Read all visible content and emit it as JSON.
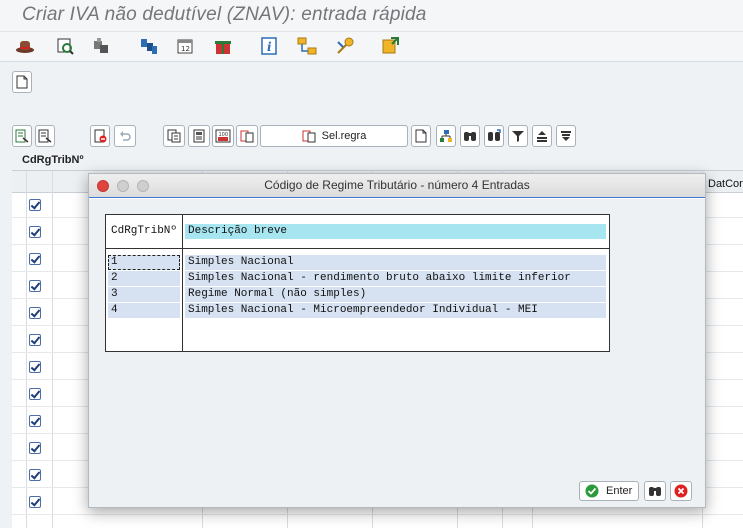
{
  "window": {
    "title": "Criar IVA não dedutível  (ZNAV): entrada rápida"
  },
  "toolbar": {
    "icons": [
      "hat-icon",
      "find-icon",
      "transport-icon",
      "structure-icon",
      "calendar-icon",
      "gift-icon",
      "info-icon",
      "flow-icon",
      "key-icon",
      "transfer-icon"
    ]
  },
  "main": {
    "sel_rule_label": "Sel.regra",
    "field_label": "CdRgTribNº",
    "column_label": "DatCor"
  },
  "dialog": {
    "title": "Código de Regime Tributário - número 4 Entradas",
    "table": {
      "headers": [
        "CdRgTribNº",
        "Descrição breve"
      ],
      "rows": [
        {
          "key": "1",
          "desc": "Simples Nacional"
        },
        {
          "key": "2",
          "desc": "Simples Nacional - rendimento bruto abaixo limite inferior"
        },
        {
          "key": "3",
          "desc": "Regime Normal (não simples)"
        },
        {
          "key": "4",
          "desc": "Simples Nacional - Microempreendedor Individual - MEI"
        }
      ]
    },
    "buttons": {
      "enter_label": "Enter"
    }
  }
}
